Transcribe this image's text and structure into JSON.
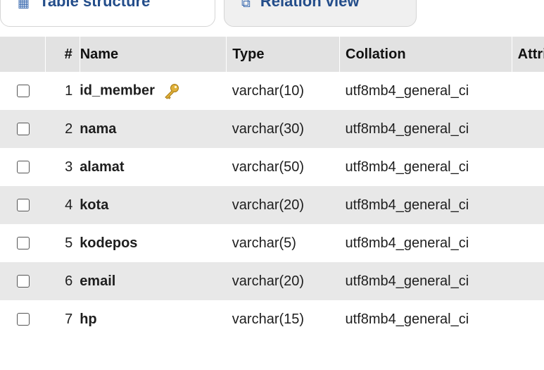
{
  "tabs": [
    {
      "label": "Table structure",
      "icon": "table-icon"
    },
    {
      "label": "Relation view",
      "icon": "relation-icon"
    }
  ],
  "table": {
    "headers": {
      "number": "#",
      "name": "Name",
      "type": "Type",
      "collation": "Collation",
      "attributes": "Attrib"
    },
    "rows": [
      {
        "number": "1",
        "name": "id_member",
        "type": "varchar(10)",
        "collation": "utf8mb4_general_ci",
        "primary_key": true
      },
      {
        "number": "2",
        "name": "nama",
        "type": "varchar(30)",
        "collation": "utf8mb4_general_ci",
        "primary_key": false
      },
      {
        "number": "3",
        "name": "alamat",
        "type": "varchar(50)",
        "collation": "utf8mb4_general_ci",
        "primary_key": false
      },
      {
        "number": "4",
        "name": "kota",
        "type": "varchar(20)",
        "collation": "utf8mb4_general_ci",
        "primary_key": false
      },
      {
        "number": "5",
        "name": "kodepos",
        "type": "varchar(5)",
        "collation": "utf8mb4_general_ci",
        "primary_key": false
      },
      {
        "number": "6",
        "name": "email",
        "type": "varchar(20)",
        "collation": "utf8mb4_general_ci",
        "primary_key": false
      },
      {
        "number": "7",
        "name": "hp",
        "type": "varchar(15)",
        "collation": "utf8mb4_general_ci",
        "primary_key": false
      }
    ]
  },
  "colors": {
    "header_bg": "#e2e2e2",
    "row_alt_bg": "#e8e8e8",
    "key_icon": "#e0b13a"
  }
}
